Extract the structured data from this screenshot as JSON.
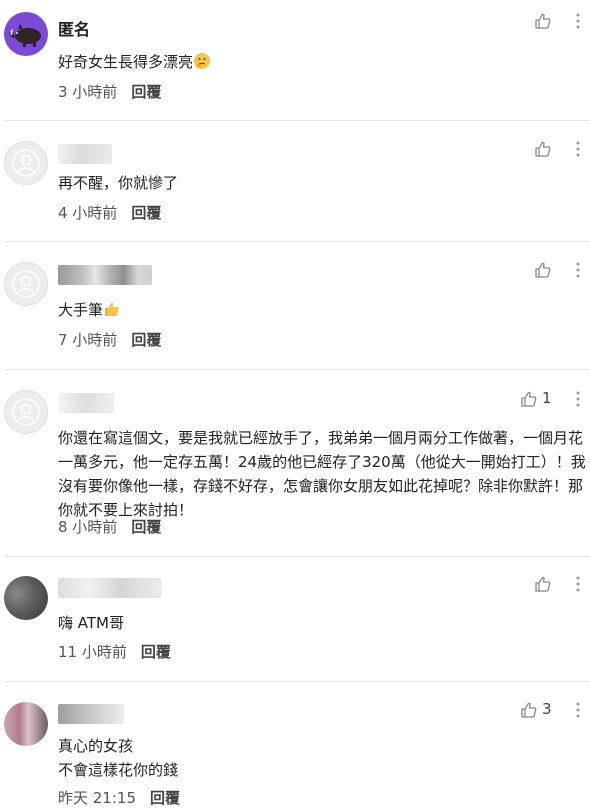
{
  "comments": [
    {
      "author": "匿名",
      "text": "好奇女生長得多漂亮",
      "emoji": "thinking-face",
      "time": "3 小時前",
      "reply": "回覆",
      "likes": ""
    },
    {
      "author": "",
      "text": "再不醒，你就慘了",
      "time": "4 小時前",
      "reply": "回覆",
      "likes": ""
    },
    {
      "author": "",
      "text": "大手筆",
      "emoji": "thumbs-up",
      "time": "7 小時前",
      "reply": "回覆",
      "likes": ""
    },
    {
      "author": "",
      "lines": [
        "你還在寫這個文，要是我就已經放手了，我弟弟一個月兩分工作做著，一個月花",
        "一萬多元，他一定存五萬！24歲的他已經存了320萬（他從大一開始打工）！我",
        "沒有要你像他一樣，存錢不好存，怎會讓你女朋友如此花掉呢？除非你默許！那",
        "你就不要上來討拍！"
      ],
      "time": "8 小時前",
      "reply": "回覆",
      "likes": "1"
    },
    {
      "author": "",
      "text": "嗨 ATM哥",
      "time": "11 小時前",
      "reply": "回覆",
      "likes": ""
    },
    {
      "author": "",
      "lines": [
        "真心的女孩",
        "不會這樣花你的錢"
      ],
      "time": "昨天 21:15",
      "reply": "回覆",
      "likes": "3"
    }
  ],
  "icons": {
    "like": "thumbs-up-outline-icon",
    "more": "vertical-ellipsis-icon",
    "anon_avatar": "boar-icon"
  },
  "colors": {
    "anon_avatar_bg": "#7b4ad6",
    "divider": "#e6e6e6",
    "meta_text": "#555555"
  }
}
